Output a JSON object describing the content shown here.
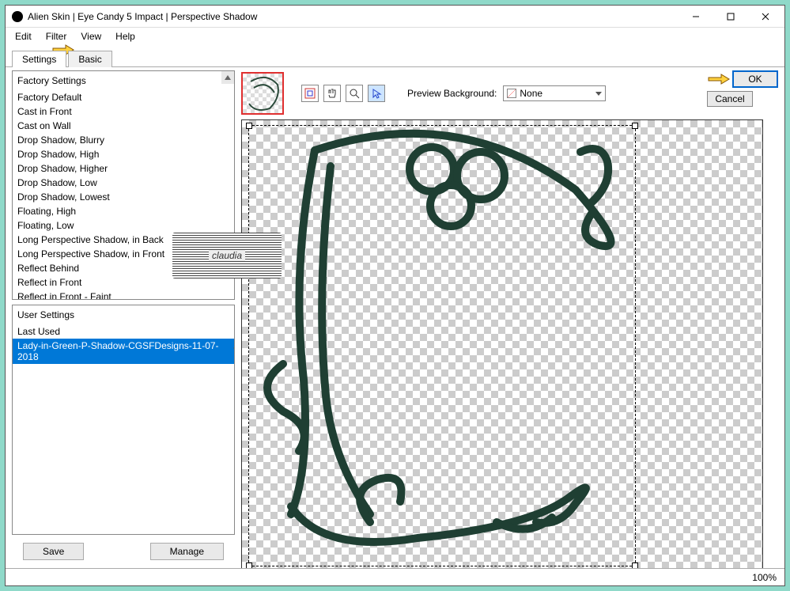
{
  "window": {
    "title": "Alien Skin | Eye Candy 5 Impact | Perspective Shadow"
  },
  "menu": {
    "edit": "Edit",
    "filter": "Filter",
    "view": "View",
    "help": "Help"
  },
  "tabs": {
    "settings": "Settings",
    "basic": "Basic"
  },
  "factory": {
    "header": "Factory Settings",
    "items": [
      "Factory Default",
      "Cast in Front",
      "Cast on Wall",
      "Drop Shadow, Blurry",
      "Drop Shadow, High",
      "Drop Shadow, Higher",
      "Drop Shadow, Low",
      "Drop Shadow, Lowest",
      "Floating, High",
      "Floating, Low",
      "Long Perspective Shadow, in Back",
      "Long Perspective Shadow, in Front",
      "Reflect Behind",
      "Reflect in Front",
      "Reflect in Front - Faint"
    ]
  },
  "user": {
    "header": "User Settings",
    "items": [
      "Last Used",
      "Lady-in-Green-P-Shadow-CGSFDesigns-11-07-2018"
    ],
    "selected_index": 1
  },
  "buttons": {
    "save": "Save",
    "manage": "Manage",
    "ok": "OK",
    "cancel": "Cancel"
  },
  "preview": {
    "label": "Preview Background:",
    "value": "None"
  },
  "watermark": "claudia",
  "status": {
    "zoom": "100%"
  }
}
